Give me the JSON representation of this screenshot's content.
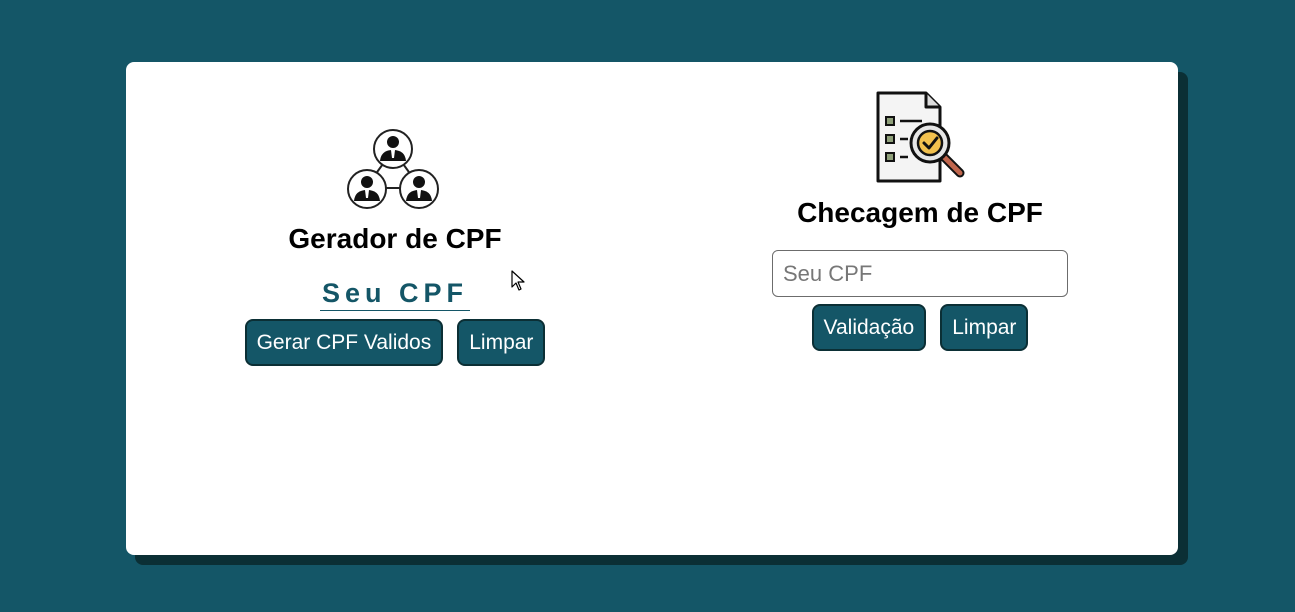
{
  "generator": {
    "title": "Gerador de CPF",
    "icon": "people-network-icon",
    "output_text": "Seu CPF",
    "generate_button_label": "Gerar CPF Validos",
    "clear_button_label": "Limpar"
  },
  "checker": {
    "title": "Checagem de CPF",
    "icon": "document-check-icon",
    "input_value": "",
    "input_placeholder": "Seu CPF",
    "validate_button_label": "Validação",
    "clear_button_label": "Limpar"
  },
  "colors": {
    "background": "#145667",
    "card": "#ffffff",
    "card_shadow": "#0b2f35",
    "button": "#145667",
    "button_border": "#0b2f35",
    "button_text": "#ffffff",
    "accent_text": "#145667"
  }
}
